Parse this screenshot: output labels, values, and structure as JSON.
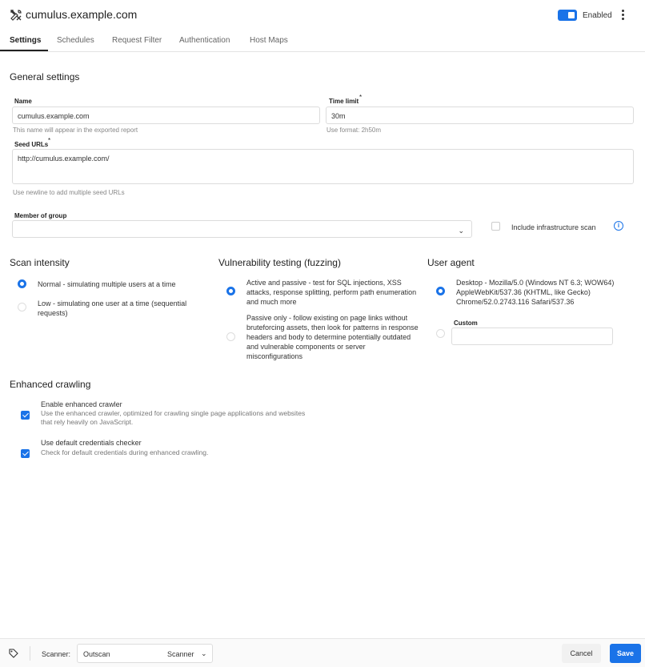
{
  "header": {
    "site_title": "cumulus.example.com",
    "enabled_label": "Enabled"
  },
  "tabs": [
    {
      "label": "Settings",
      "active": true
    },
    {
      "label": "Schedules"
    },
    {
      "label": "Request Filter"
    },
    {
      "label": "Authentication"
    },
    {
      "label": "Host Maps"
    }
  ],
  "general": {
    "title": "General settings",
    "name_label": "Name",
    "name_value": "cumulus.example.com",
    "name_hint": "This name will appear in the exported report",
    "time_limit_label": "Time limit",
    "required_mark": "*",
    "time_limit_value": "30m",
    "time_limit_hint": "Use format: 2h50m",
    "seed_urls_label": "Seed URLs",
    "seed_urls_value": "http://cumulus.example.com/",
    "seed_urls_hint": "Use newline to add multiple seed URLs",
    "member_of_group_label": "Member of group",
    "member_of_group_value": "",
    "include_infra_label": "Include infrastructure scan"
  },
  "scan_intensity": {
    "title": "Scan intensity",
    "options": [
      {
        "label": "Normal - simulating multiple users at a time",
        "selected": true
      },
      {
        "label": "Low - simulating one user at a time (sequential requests)",
        "selected": false
      }
    ]
  },
  "fuzzing": {
    "title": "Vulnerability testing (fuzzing)",
    "options": [
      {
        "label": "Active and passive - test for SQL injections, XSS attacks, response splitting, perform path enumeration and much more",
        "selected": true
      },
      {
        "label": "Passive only - follow existing on page links without bruteforcing assets, then look for patterns in response headers and body to determine potentially outdated and vulnerable components or server misconfigurations",
        "selected": false
      }
    ]
  },
  "user_agent": {
    "title": "User agent",
    "desktop_label": "Desktop - Mozilla/5.0 (Windows NT 6.3; WOW64) AppleWebKit/537.36 (KHTML, like Gecko) Chrome/52.0.2743.116 Safari/537.36",
    "custom_label": "Custom",
    "custom_value": ""
  },
  "enhanced": {
    "title": "Enhanced crawling",
    "items": [
      {
        "label": "Enable enhanced crawler",
        "desc": "Use the enhanced crawler, optimized for crawling single page applications and websites that rely heavily on JavaScript.",
        "checked": true
      },
      {
        "label": "Use default credentials checker",
        "desc": "Check for default credentials during enhanced crawling.",
        "checked": true
      }
    ]
  },
  "footer": {
    "scanner_label": "Scanner:",
    "scanner_value": "Outscan",
    "scanner_type": "Scanner",
    "cancel_label": "Cancel",
    "save_label": "Save"
  },
  "colors": {
    "accent": "#1a73e8"
  }
}
